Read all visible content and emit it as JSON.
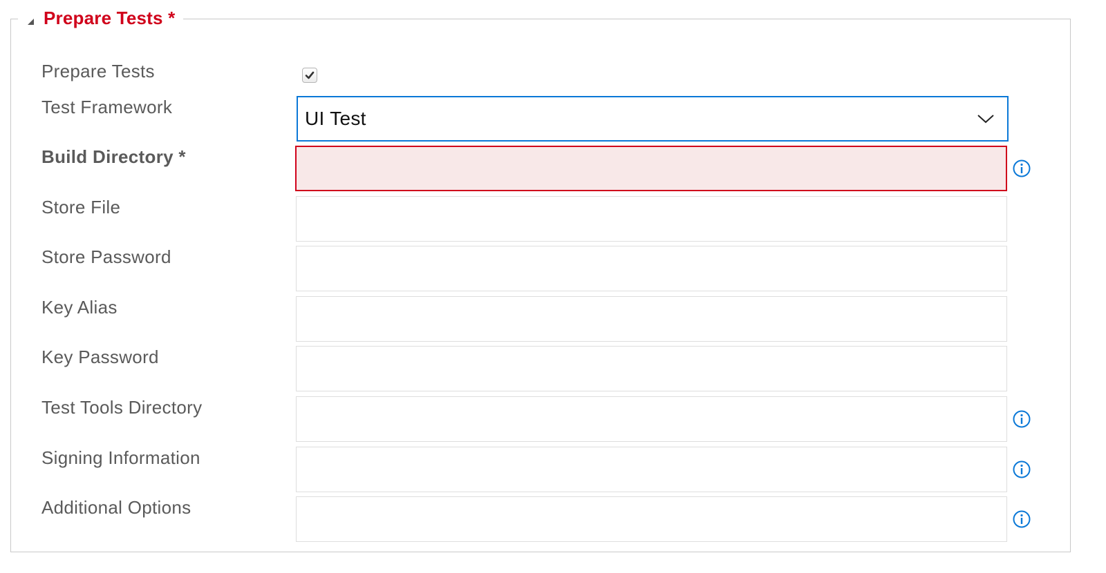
{
  "section": {
    "title": "Prepare Tests *",
    "collapse_icon": "collapse-triangle-icon"
  },
  "colors": {
    "required_red": "#d0021b",
    "focus_blue": "#0a78d7",
    "error_bg": "#f8e8e8",
    "label_gray": "#5a5a5a"
  },
  "fields": {
    "prepare_tests": {
      "label": "Prepare Tests",
      "checked": true
    },
    "test_framework": {
      "label": "Test Framework",
      "value": "UI Test"
    },
    "build_directory": {
      "label": "Build Directory *",
      "value": "",
      "state": "error"
    },
    "store_file": {
      "label": "Store File",
      "value": ""
    },
    "store_password": {
      "label": "Store Password",
      "value": ""
    },
    "key_alias": {
      "label": "Key Alias",
      "value": ""
    },
    "key_password": {
      "label": "Key Password",
      "value": ""
    },
    "test_tools_directory": {
      "label": "Test Tools Directory",
      "value": ""
    },
    "signing_information": {
      "label": "Signing Information",
      "value": ""
    },
    "additional_options": {
      "label": "Additional Options",
      "value": ""
    }
  },
  "icons": {
    "info": "info-icon",
    "dropdown": "chevron-down-icon",
    "check": "checkmark-icon"
  }
}
